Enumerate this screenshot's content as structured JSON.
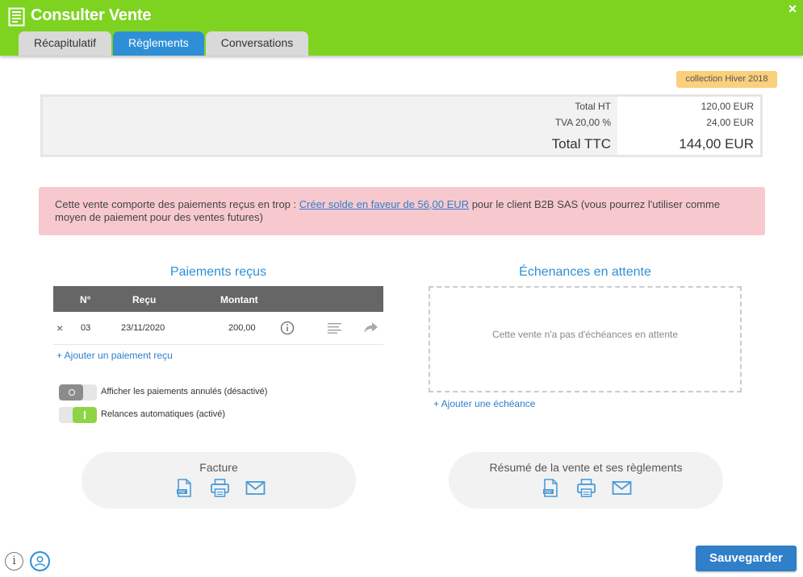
{
  "window": {
    "title": "Consulter Vente",
    "close_label": "×"
  },
  "tabs": [
    {
      "label": "Récapitulatif"
    },
    {
      "label": "Règlements"
    },
    {
      "label": "Conversations"
    }
  ],
  "collection_badge": "collection Hiver 2018",
  "totals": {
    "total_ht_label": "Total HT",
    "total_ht_value": "120,00 EUR",
    "tva_label": "TVA 20,00 %",
    "tva_value": "24,00 EUR",
    "total_ttc_label": "Total TTC",
    "total_ttc_value": "144,00 EUR"
  },
  "alert": {
    "text_before": "Cette vente comporte des paiements reçus en trop : ",
    "link": "Créer solde en faveur de 56,00 EUR",
    "text_after": " pour le client B2B SAS (vous pourrez l'utiliser comme moyen de paiement pour des ventes futures)"
  },
  "payments": {
    "title": "Paiements reçus",
    "columns": {
      "number": "N°",
      "received": "Reçu",
      "amount": "Montant"
    },
    "rows": [
      {
        "delete": "×",
        "number": "03",
        "date": "23/11/2020",
        "amount": "200,00"
      }
    ],
    "add_link": "+ Ajouter un paiement reçu"
  },
  "toggles": {
    "cancelled": {
      "label": "Afficher les paiements annulés (désactivé)",
      "state": "off"
    },
    "reminders": {
      "label": "Relances automatiques (activé)",
      "state": "on"
    }
  },
  "schedules": {
    "title": "Échenances en attente",
    "empty_text": "Cette vente n'a pas d'échéances en attente",
    "add_link": "+ Ajouter une échéance"
  },
  "invoice_box": {
    "title": "Facture",
    "icons": [
      "pdf-icon",
      "print-icon",
      "email-icon"
    ]
  },
  "summary_box": {
    "title": "Résumé de la vente et ses règlements",
    "icons": [
      "pdf-icon",
      "print-icon",
      "email-icon"
    ]
  },
  "footer": {
    "save_label": "Sauvegarder",
    "info_label": "i"
  },
  "colors": {
    "header": "#7ed321",
    "accent": "#2f8fd6",
    "alert_bg": "#f7c9cf",
    "badge": "#fbd07c"
  }
}
